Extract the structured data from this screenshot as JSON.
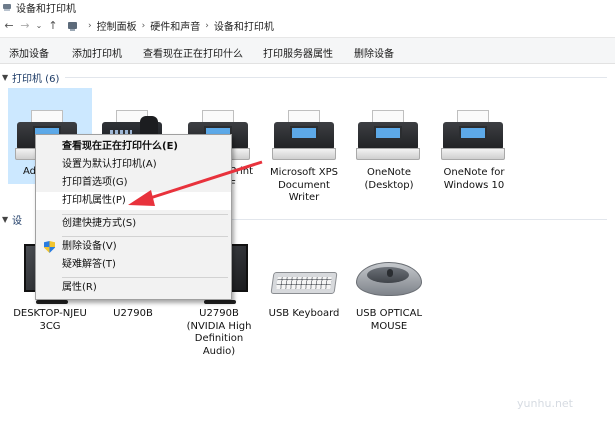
{
  "window": {
    "title": "设备和打印机",
    "icon": "devices-printers-icon"
  },
  "address": {
    "back_icon": "back-arrow-icon",
    "forward_icon": "forward-arrow-icon",
    "dropdown_icon": "chevron-down-icon",
    "up_icon": "up-arrow-icon",
    "crumbs": [
      "控制面板",
      "硬件和声音",
      "设备和打印机"
    ]
  },
  "commands": [
    "添加设备",
    "添加打印机",
    "查看现在正在打印什么",
    "打印服务器属性",
    "删除设备"
  ],
  "printers_group": {
    "label": "打印机 (6)",
    "items": [
      {
        "label": "Ad",
        "icon": "printer-icon",
        "selected": true
      },
      {
        "label": "",
        "icon": "fax-icon"
      },
      {
        "label": "Print\nF",
        "icon": "printer-icon"
      },
      {
        "label": "Microsoft XPS\nDocument\nWriter",
        "icon": "printer-icon"
      },
      {
        "label": "OneNote\n(Desktop)",
        "icon": "printer-icon"
      },
      {
        "label": "OneNote for\nWindows 10",
        "icon": "printer-icon"
      }
    ]
  },
  "devices_group": {
    "label": "设",
    "items": [
      {
        "label": "DESKTOP-NJEU\n3CG",
        "icon": "computer-icon"
      },
      {
        "label": "U2790B",
        "icon": "monitor-icon"
      },
      {
        "label": "U2790B\n(NVIDIA High\nDefinition\nAudio)",
        "icon": "monitor-icon"
      },
      {
        "label": "USB Keyboard",
        "icon": "keyboard-icon"
      },
      {
        "label": "USB OPTICAL\nMOUSE",
        "icon": "mouse-icon"
      }
    ]
  },
  "context_menu": {
    "items": [
      {
        "label": "查看现在正在打印什么(E)",
        "bold": true
      },
      {
        "label": "设置为默认打印机(A)"
      },
      {
        "label": "打印首选项(G)"
      },
      {
        "label": "打印机属性(P)",
        "highlighted": true
      },
      {
        "label": "创建快捷方式(S)"
      },
      {
        "label": "删除设备(V)",
        "icon": "uac-shield-icon"
      },
      {
        "label": "疑难解答(T)"
      },
      {
        "label": "属性(R)"
      }
    ]
  },
  "annotation_arrow_color": "#e8323c",
  "watermark": "yunhu.net"
}
